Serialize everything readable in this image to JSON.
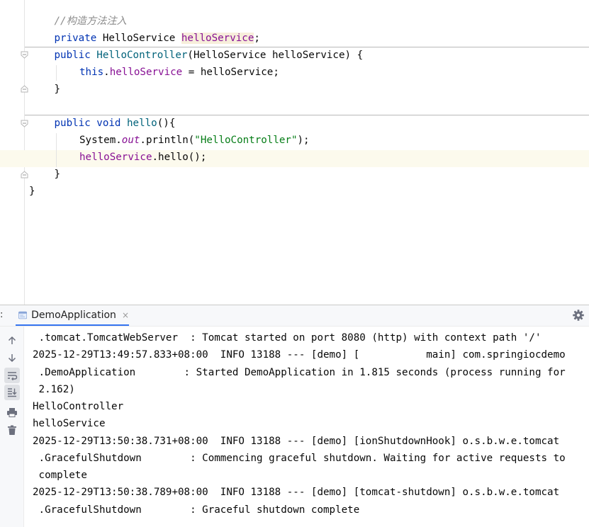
{
  "editor": {
    "lines": [
      {
        "indent": 1,
        "tokens": [
          {
            "t": "//构造方法注入",
            "c": "cmt"
          }
        ]
      },
      {
        "indent": 1,
        "tokens": [
          {
            "t": "private",
            "c": "kw"
          },
          {
            "t": " HelloService ",
            "c": ""
          },
          {
            "t": "helloService",
            "c": "fld hl"
          },
          {
            "t": ";",
            "c": ""
          }
        ]
      },
      {
        "indent": 1,
        "tokens": [
          {
            "t": "public",
            "c": "kw"
          },
          {
            "t": " ",
            "c": ""
          },
          {
            "t": "HelloController",
            "c": "fn"
          },
          {
            "t": "(HelloService helloService) {",
            "c": ""
          }
        ]
      },
      {
        "indent": 2,
        "tokens": [
          {
            "t": "this",
            "c": "kw"
          },
          {
            "t": ".",
            "c": ""
          },
          {
            "t": "helloService",
            "c": "fld"
          },
          {
            "t": " = helloService;",
            "c": ""
          }
        ]
      },
      {
        "indent": 1,
        "tokens": [
          {
            "t": "}",
            "c": ""
          }
        ]
      },
      {
        "indent": 0,
        "tokens": []
      },
      {
        "indent": 1,
        "tokens": [
          {
            "t": "public",
            "c": "kw"
          },
          {
            "t": " ",
            "c": ""
          },
          {
            "t": "void",
            "c": "kw"
          },
          {
            "t": " ",
            "c": ""
          },
          {
            "t": "hello",
            "c": "fn"
          },
          {
            "t": "(){",
            "c": ""
          }
        ]
      },
      {
        "indent": 2,
        "tokens": [
          {
            "t": "System.",
            "c": ""
          },
          {
            "t": "out",
            "c": "sfld"
          },
          {
            "t": ".println(",
            "c": ""
          },
          {
            "t": "\"HelloController\"",
            "c": "str"
          },
          {
            "t": ");",
            "c": ""
          }
        ]
      },
      {
        "indent": 2,
        "tokens": [
          {
            "t": "helloService",
            "c": "fld"
          },
          {
            "t": ".hello();",
            "c": ""
          }
        ]
      },
      {
        "indent": 1,
        "tokens": [
          {
            "t": "}",
            "c": ""
          }
        ]
      },
      {
        "indent": 0,
        "tokens": [
          {
            "t": "}",
            "c": ""
          }
        ]
      }
    ]
  },
  "run_panel": {
    "colon": ":",
    "tab_label": "DemoApplication",
    "close_glyph": "×",
    "console_lines": [
      " .tomcat.TomcatWebServer  : Tomcat started on port 8080 (http) with context path '/'",
      "2025-12-29T13:49:57.833+08:00  INFO 13188 --- [demo] [           main] com.springiocdemo",
      " .DemoApplication        : Started DemoApplication in 1.815 seconds (process running for",
      " 2.162)",
      "HelloController",
      "helloService",
      "2025-12-29T13:50:38.731+08:00  INFO 13188 --- [demo] [ionShutdownHook] o.s.b.w.e.tomcat",
      " .GracefulShutdown        : Commencing graceful shutdown. Waiting for active requests to",
      " complete",
      "2025-12-29T13:50:38.789+08:00  INFO 13188 --- [demo] [tomcat-shutdown] o.s.b.w.e.tomcat",
      " .GracefulShutdown        : Graceful shutdown complete"
    ]
  },
  "icons": {
    "toolbar": [
      "arrow-up-icon",
      "arrow-down-icon",
      "soft-wrap-icon",
      "scroll-to-end-icon",
      "print-icon",
      "trash-icon"
    ],
    "settings": "gear-icon"
  },
  "colors": {
    "keyword": "#0033b3",
    "field": "#871094",
    "method": "#00627a",
    "string": "#067d17",
    "comment": "#8c8c8c",
    "caret_line": "#fcfaed",
    "accent": "#3574f0"
  }
}
